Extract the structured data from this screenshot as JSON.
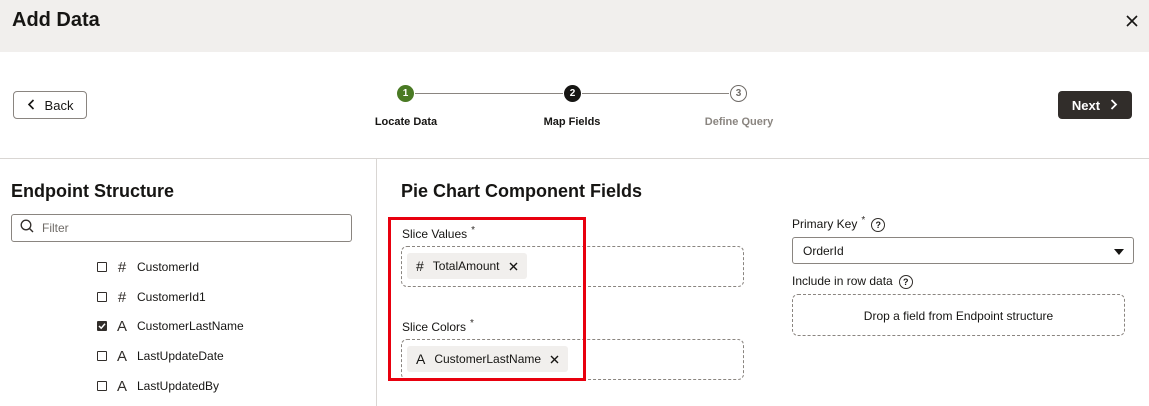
{
  "dialog": {
    "title": "Add Data"
  },
  "nav": {
    "back_label": "Back",
    "next_label": "Next"
  },
  "stepper": {
    "steps": [
      {
        "number": "1",
        "label": "Locate Data",
        "state": "complete",
        "color": "#4a7a24"
      },
      {
        "number": "2",
        "label": "Map Fields",
        "state": "current",
        "color": "#161513"
      },
      {
        "number": "3",
        "label": "Define Query",
        "state": "upcoming",
        "color": "#8a8580"
      }
    ]
  },
  "endpoint": {
    "title": "Endpoint Structure",
    "filter_placeholder": "Filter",
    "items": [
      {
        "name": "CustomerId",
        "type_icon": "#",
        "checked": false
      },
      {
        "name": "CustomerId1",
        "type_icon": "#",
        "checked": false
      },
      {
        "name": "CustomerLastName",
        "type_icon": "A",
        "checked": true
      },
      {
        "name": "LastUpdateDate",
        "type_icon": "A",
        "checked": false
      },
      {
        "name": "LastUpdatedBy",
        "type_icon": "A",
        "checked": false
      }
    ]
  },
  "component": {
    "title": "Pie Chart Component Fields",
    "slice_values": {
      "label": "Slice Values",
      "required_mark": "*",
      "chip": {
        "label": "TotalAmount",
        "type_icon": "#"
      }
    },
    "slice_colors": {
      "label": "Slice Colors",
      "required_mark": "*",
      "chip": {
        "label": "CustomerLastName",
        "type_icon": "A"
      }
    },
    "primary_key": {
      "label": "Primary Key",
      "required_mark": "*",
      "help_icon": "?",
      "value": "OrderId"
    },
    "row_data": {
      "label": "Include in row data",
      "help_icon": "?",
      "drop_hint": "Drop a field from Endpoint structure"
    }
  },
  "colors": {
    "highlight": "#e8000e",
    "step_complete": "#4a7a24",
    "primary_button": "#312d2a",
    "header_bg": "#f1efed"
  }
}
